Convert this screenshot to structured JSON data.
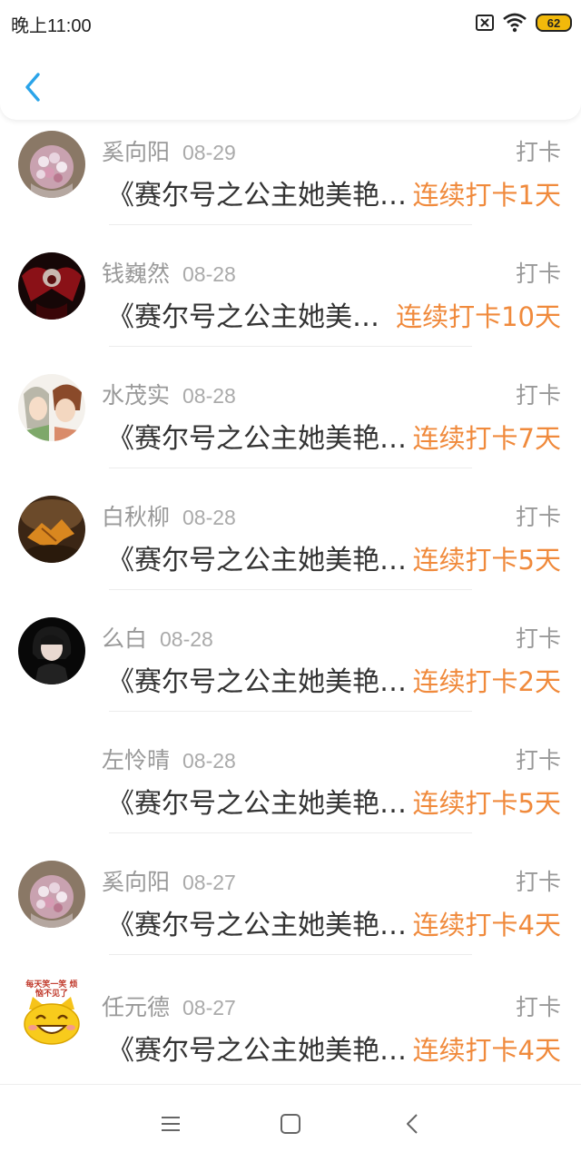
{
  "status_bar": {
    "time": "晚上11:00",
    "battery": "62"
  },
  "header": {
    "back_icon": "chevron-left-icon",
    "accent_color": "#2aa4e9"
  },
  "items": [
    {
      "name": "奚向阳",
      "date": "08-29",
      "type": "打卡",
      "title": "《赛尔号之公主她美艳…",
      "streak": "连续打卡1天",
      "avatar": "flowers"
    },
    {
      "name": "钱巍然",
      "date": "08-28",
      "type": "打卡",
      "title": "《赛尔号之公主她美…",
      "streak": "连续打卡10天",
      "avatar": "dark-red"
    },
    {
      "name": "水茂实",
      "date": "08-28",
      "type": "打卡",
      "title": "《赛尔号之公主她美艳…",
      "streak": "连续打卡7天",
      "avatar": "anime-couple"
    },
    {
      "name": "白秋柳",
      "date": "08-28",
      "type": "打卡",
      "title": "《赛尔号之公主她美艳…",
      "streak": "连续打卡5天",
      "avatar": "autumn-leaf"
    },
    {
      "name": "么白",
      "date": "08-28",
      "type": "打卡",
      "title": "《赛尔号之公主她美艳…",
      "streak": "连续打卡2天",
      "avatar": "girl-dark"
    },
    {
      "name": "左怜晴",
      "date": "08-28",
      "type": "打卡",
      "title": "《赛尔号之公主她美艳…",
      "streak": "连续打卡5天",
      "avatar": ""
    },
    {
      "name": "奚向阳",
      "date": "08-27",
      "type": "打卡",
      "title": "《赛尔号之公主她美艳…",
      "streak": "连续打卡4天",
      "avatar": "flowers"
    },
    {
      "name": "任元德",
      "date": "08-27",
      "type": "打卡",
      "title": "《赛尔号之公主她美艳…",
      "streak": "连续打卡4天",
      "avatar": "smiley-cat",
      "avatar_text": "每天笑一笑 烦恼不见了"
    }
  ],
  "nav_bar": {
    "menu_icon": "menu-icon",
    "home_icon": "square-home-icon",
    "back_icon": "triangle-back-icon"
  },
  "colors": {
    "streak": "#f08a3c",
    "name": "#999999",
    "title": "#333333"
  }
}
